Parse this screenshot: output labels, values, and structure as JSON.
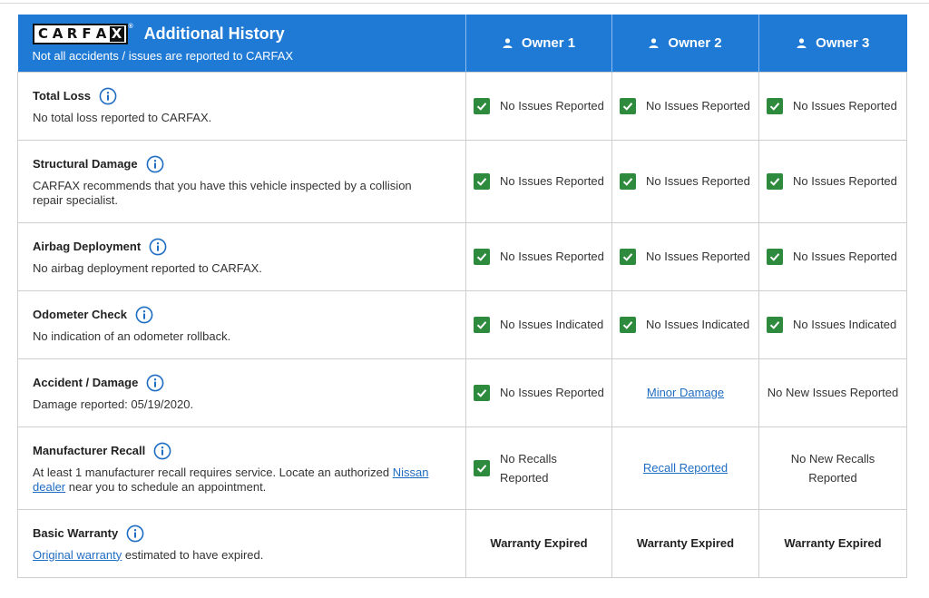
{
  "header": {
    "logo_text": "CARFAX",
    "title": "Additional History",
    "subtitle": "Not all accidents / issues are reported to CARFAX",
    "owners": [
      "Owner 1",
      "Owner 2",
      "Owner 3"
    ]
  },
  "colors": {
    "header_bg": "#1f7ad6",
    "check_green": "#2e8b3e",
    "link_blue": "#1f6dc2"
  },
  "rows": [
    {
      "title": "Total Loss",
      "desc": "No total loss reported to CARFAX.",
      "status": [
        "No Issues Reported",
        "No Issues Reported",
        "No Issues Reported"
      ]
    },
    {
      "title": "Structural Damage",
      "desc": "CARFAX recommends that you have this vehicle inspected by a collision repair specialist.",
      "status": [
        "No Issues Reported",
        "No Issues Reported",
        "No Issues Reported"
      ]
    },
    {
      "title": "Airbag Deployment",
      "desc": "No airbag deployment reported to CARFAX.",
      "status": [
        "No Issues Reported",
        "No Issues Reported",
        "No Issues Reported"
      ]
    },
    {
      "title": "Odometer Check",
      "desc": "No indication of an odometer rollback.",
      "status": [
        "No Issues Indicated",
        "No Issues Indicated",
        "No Issues Indicated"
      ]
    },
    {
      "title": "Accident / Damage",
      "desc": "Damage reported: 05/19/2020.",
      "status": [
        "No Issues Reported",
        "Minor Damage",
        "No New Issues Reported"
      ]
    },
    {
      "title": "Manufacturer Recall",
      "desc_pre": "At least 1 manufacturer recall requires service. Locate an authorized ",
      "desc_link": "Nissan dealer",
      "desc_post": " near you to schedule an appointment.",
      "status": [
        "No Recalls Reported",
        "Recall Reported",
        "No New Recalls Reported"
      ]
    },
    {
      "title": "Basic Warranty",
      "desc_link": "Original warranty",
      "desc_post": " estimated to have expired.",
      "status": [
        "Warranty Expired",
        "Warranty Expired",
        "Warranty Expired"
      ]
    }
  ]
}
